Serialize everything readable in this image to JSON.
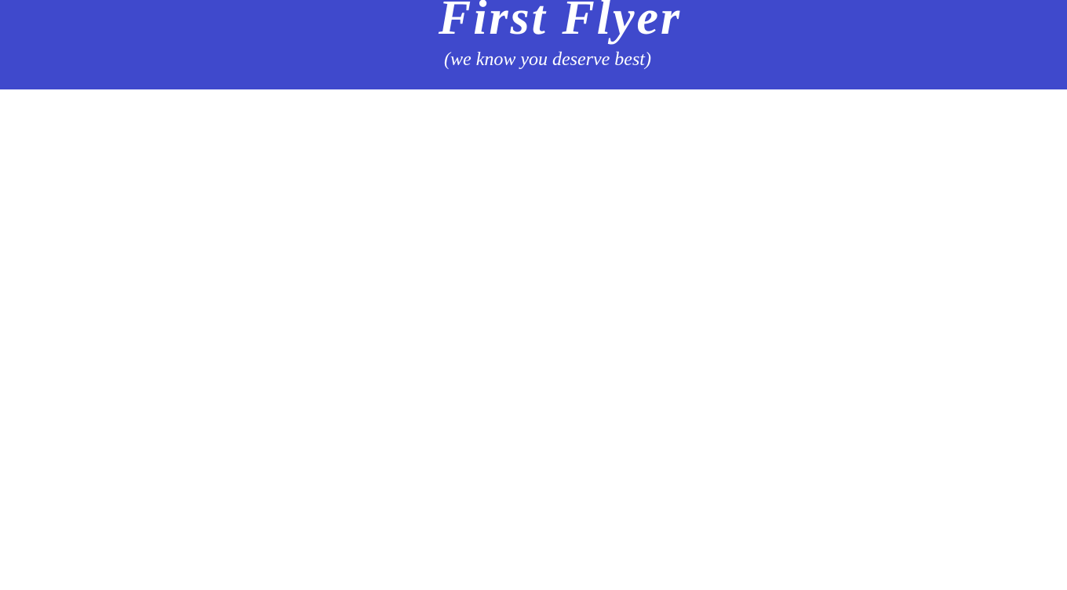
{
  "header": {
    "title": "First Flyer",
    "tagline": "(we know you deserve best)"
  },
  "colors": {
    "header_background": "#3f49cc",
    "header_text": "#ffffff",
    "page_background": "#ffffff"
  }
}
